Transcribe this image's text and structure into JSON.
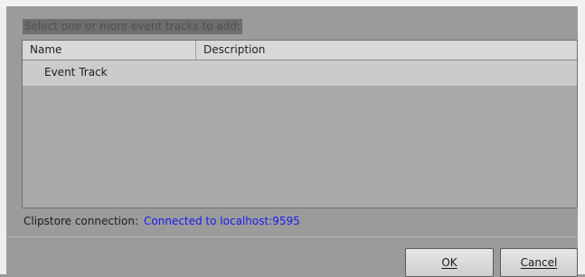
{
  "dialog": {
    "prompt": "Select one or more event tracks to add:",
    "columns": [
      {
        "label": "Name"
      },
      {
        "label": "Description"
      }
    ],
    "rows": [
      {
        "name": "Event Track",
        "description": ""
      }
    ],
    "connection": {
      "label": "Clipstore connection:",
      "value": "Connected to localhost:9595"
    },
    "buttons": {
      "ok_label": "OK",
      "cancel_label": "Cancel"
    }
  },
  "colors": {
    "connection_value": "#1a1aee",
    "dialog_background": "#9b9b9b"
  }
}
